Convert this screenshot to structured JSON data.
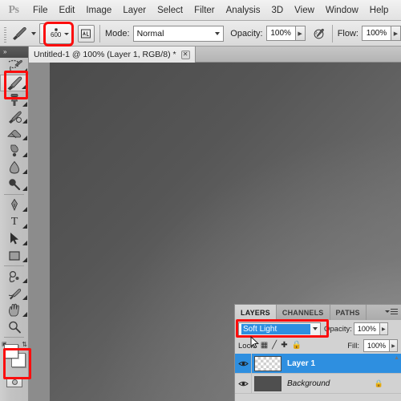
{
  "app": {
    "name": "Adobe Photoshop",
    "logo": "Ps"
  },
  "menubar": {
    "items": [
      {
        "label": "File"
      },
      {
        "label": "Edit"
      },
      {
        "label": "Image"
      },
      {
        "label": "Layer"
      },
      {
        "label": "Select"
      },
      {
        "label": "Filter"
      },
      {
        "label": "Analysis"
      },
      {
        "label": "3D"
      },
      {
        "label": "View"
      },
      {
        "label": "Window"
      },
      {
        "label": "Help"
      }
    ]
  },
  "options_bar": {
    "tool": "brush-tool",
    "brush_size": "600",
    "mode_label": "Mode:",
    "mode_value": "Normal",
    "opacity_label": "Opacity:",
    "opacity_value": "100%",
    "flow_label": "Flow:",
    "flow_value": "100%",
    "airbrush": "airbrush-icon",
    "toggle_panel": "toggle-brush-panel"
  },
  "document_tab": {
    "title": "Untitled-1 @ 100% (Layer 1, RGB/8) *",
    "close": "✕"
  },
  "toolbar": {
    "collapse": "»",
    "tools": [
      {
        "name": "lasso-tool",
        "glyph": "lasso"
      },
      {
        "name": "brush-tool",
        "glyph": "brush",
        "selected": true
      },
      {
        "name": "clone-stamp-tool",
        "glyph": "stamp"
      },
      {
        "name": "history-brush-tool",
        "glyph": "history"
      },
      {
        "name": "eraser-tool",
        "glyph": "eraser"
      },
      {
        "name": "gradient-tool",
        "glyph": "gradient"
      },
      {
        "name": "blur-tool",
        "glyph": "blur"
      },
      {
        "name": "dodge-tool",
        "glyph": "dodge"
      },
      {
        "name": "pen-tool",
        "glyph": "pen"
      },
      {
        "name": "type-tool",
        "glyph": "T"
      },
      {
        "name": "path-selection-tool",
        "glyph": "arrow"
      },
      {
        "name": "rectangle-tool",
        "glyph": "rect"
      },
      {
        "name": "notes-tool",
        "glyph": "notes"
      },
      {
        "name": "eyedropper-tool",
        "glyph": "eyedropper"
      },
      {
        "name": "hand-tool",
        "glyph": "hand"
      },
      {
        "name": "zoom-tool",
        "glyph": "zoom"
      }
    ],
    "foreground_color": "#ffffff",
    "background_color": "#ffffff",
    "reset_colors": "reset-colors",
    "swap_colors": "swap-colors",
    "quick_mask": "quick-mask-mode"
  },
  "layers_panel": {
    "tabs": [
      {
        "label": "LAYERS",
        "active": true
      },
      {
        "label": "CHANNELS",
        "active": false
      },
      {
        "label": "PATHS",
        "active": false
      }
    ],
    "blend_mode": "Soft Light",
    "opacity_label": "Opacity:",
    "opacity_value": "100%",
    "lock_label": "Lock:",
    "lock_icons": [
      "lock-transparent-pixels",
      "lock-image-pixels",
      "lock-position",
      "lock-all"
    ],
    "fill_label": "Fill:",
    "fill_value": "100%",
    "layers": [
      {
        "name": "Layer 1",
        "visible": true,
        "selected": true,
        "thumb": "transparent",
        "locked": false
      },
      {
        "name": "Background",
        "visible": true,
        "selected": false,
        "thumb": "solid",
        "locked": true
      }
    ]
  },
  "annotations": {
    "color": "#fb0d0d",
    "regions": [
      {
        "name": "brush-size-highlight"
      },
      {
        "name": "brush-tool-highlight"
      },
      {
        "name": "color-swatch-highlight"
      },
      {
        "name": "blend-mode-highlight"
      }
    ]
  },
  "canvas": {
    "gradient_from": "#4b4b4b",
    "gradient_to": "#7c7c7c"
  }
}
